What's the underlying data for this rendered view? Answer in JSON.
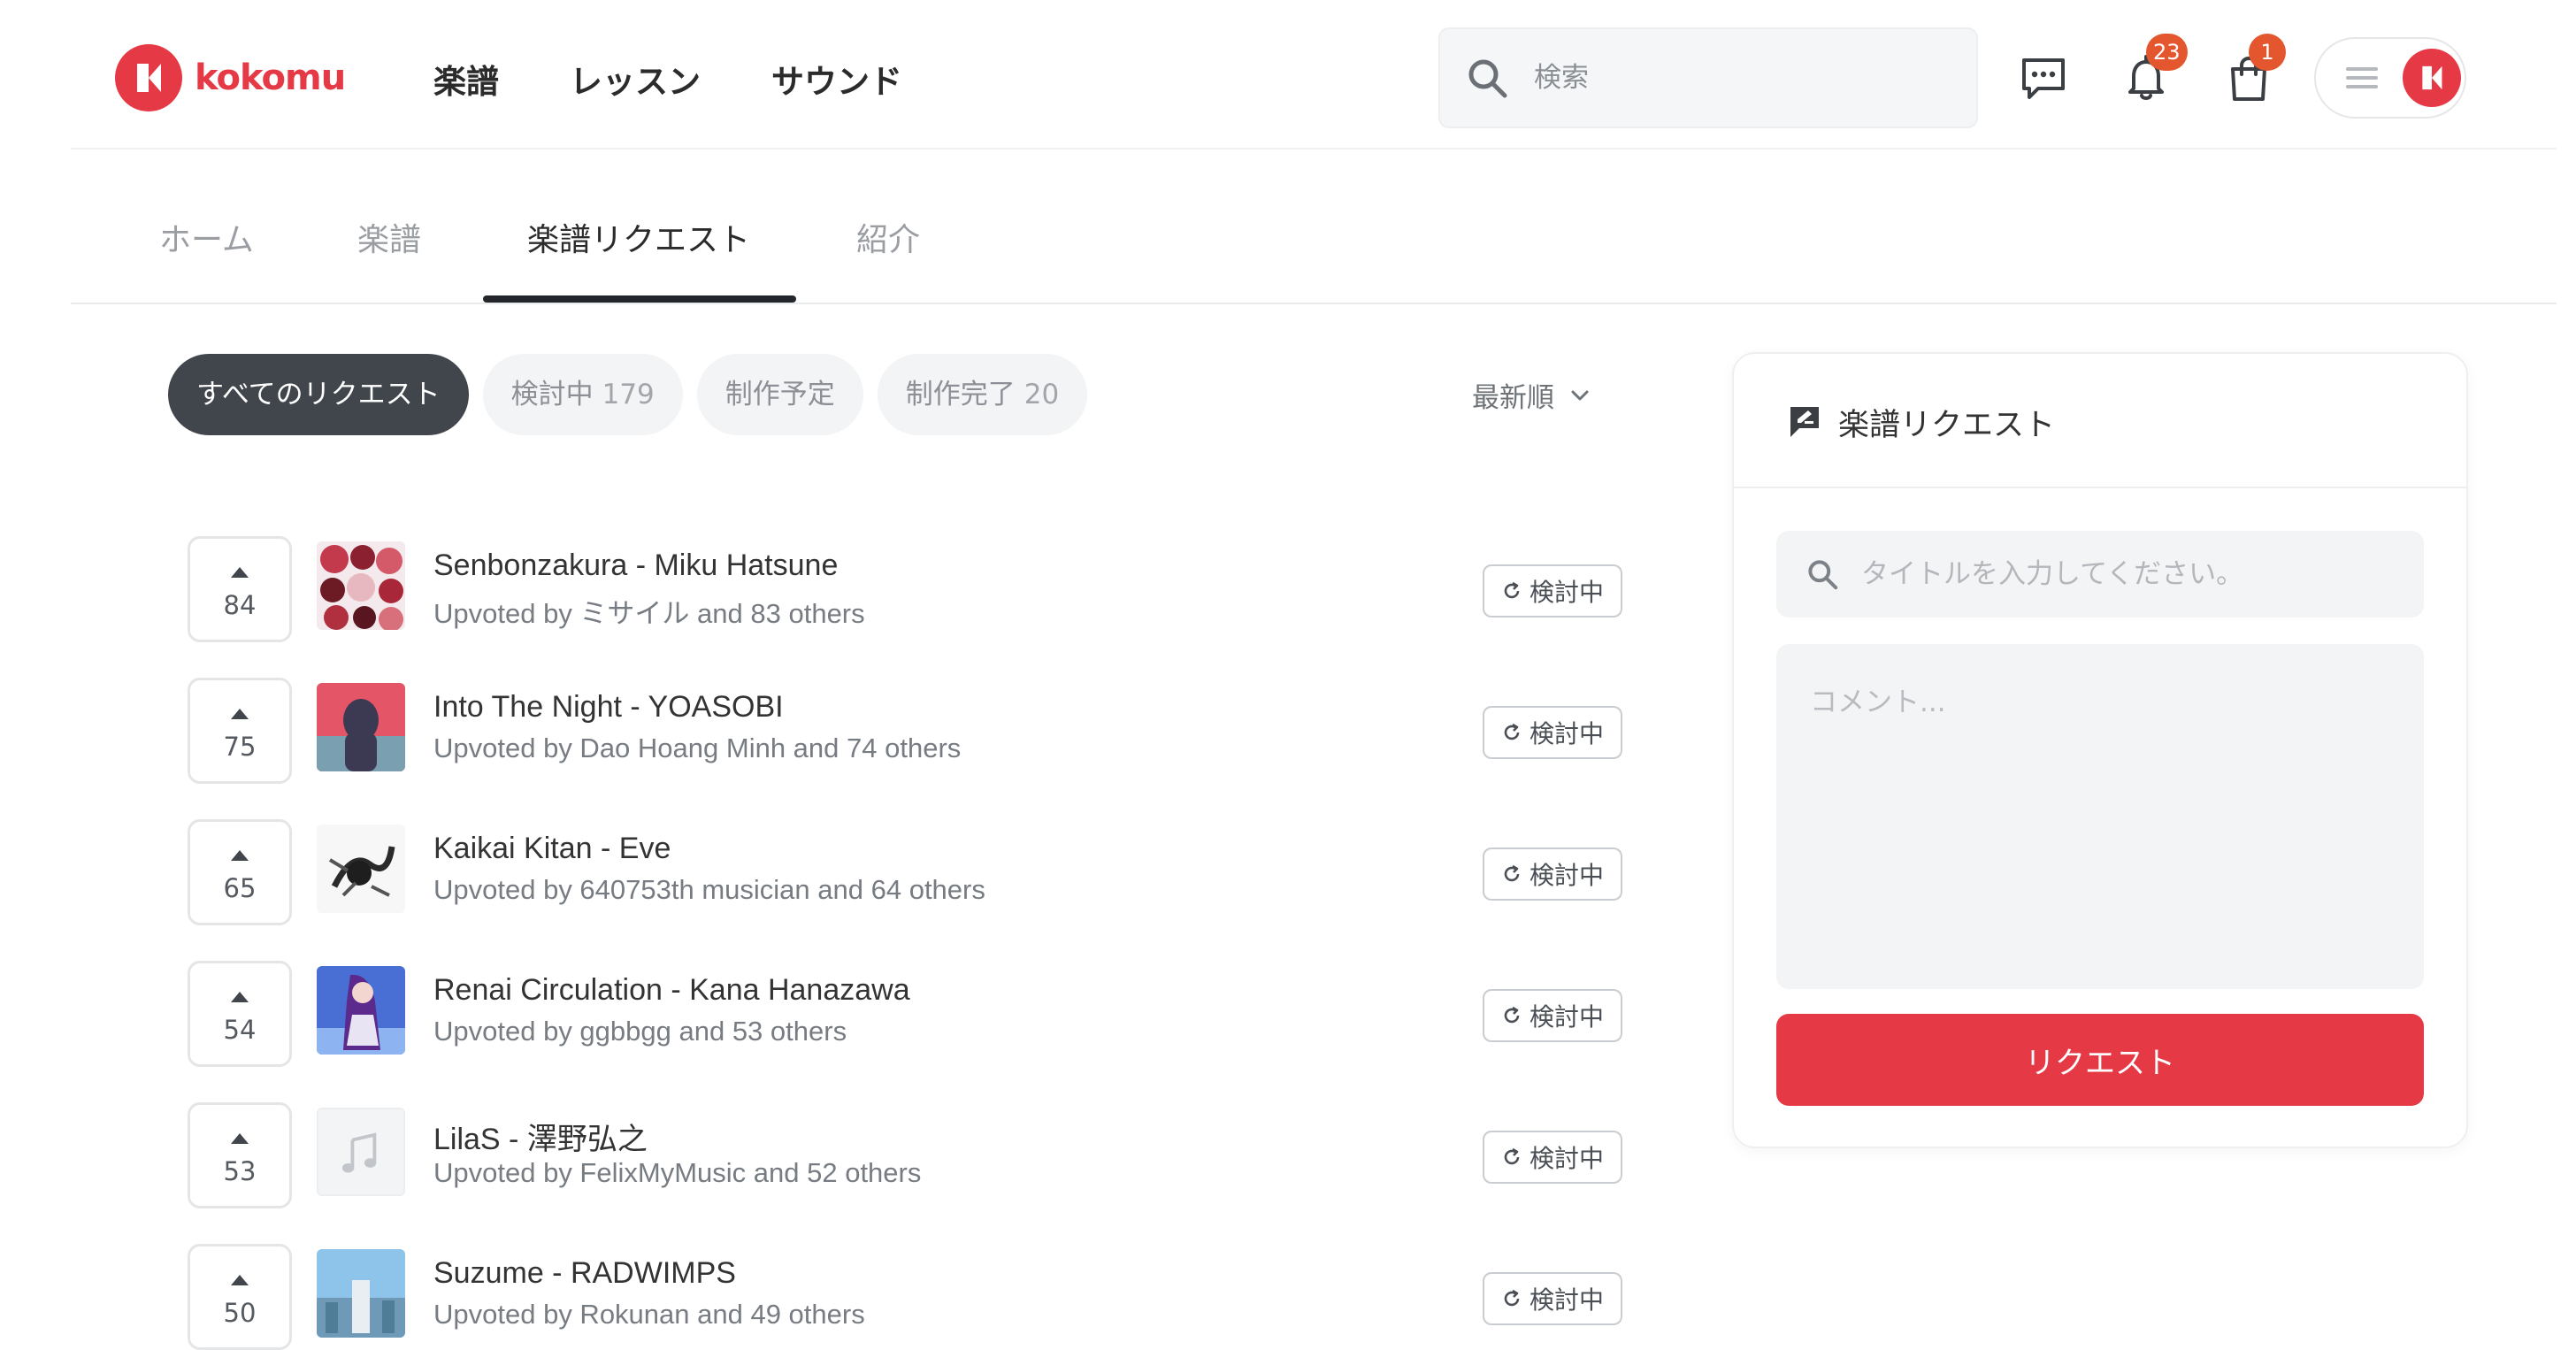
{
  "brand": {
    "name": "kokomu",
    "color": "#e63946"
  },
  "main_nav": [
    {
      "label": "楽譜"
    },
    {
      "label": "レッスン"
    },
    {
      "label": "サウンド"
    }
  ],
  "search": {
    "placeholder": "検索"
  },
  "header_icons": {
    "messages": {
      "icon": "chat-icon"
    },
    "notifications": {
      "icon": "bell-icon",
      "badge": "23"
    },
    "cart": {
      "icon": "shopping-bag-icon",
      "badge": "1"
    },
    "user_menu": {
      "icon": "menu-icon"
    }
  },
  "subtabs": [
    {
      "label": "ホーム",
      "active": false
    },
    {
      "label": "楽譜",
      "active": false
    },
    {
      "label": "楽譜リクエスト",
      "active": true
    },
    {
      "label": "紹介",
      "active": false
    }
  ],
  "filters": [
    {
      "label": "すべてのリクエスト",
      "count": "",
      "active": true
    },
    {
      "label": "検討中",
      "count": "179",
      "active": false
    },
    {
      "label": "制作予定",
      "count": "",
      "active": false
    },
    {
      "label": "制作完了",
      "count": "20",
      "active": false
    }
  ],
  "sort": {
    "label": "最新順"
  },
  "requests": [
    {
      "votes": "84",
      "title": "Senbonzakura - Miku Hatsune",
      "upvoted": "Upvoted by ミサイル and 83 others",
      "status": "検討中",
      "thumb": "collage"
    },
    {
      "votes": "75",
      "title": "Into The Night - YOASOBI",
      "upvoted": "Upvoted by Dao Hoang Minh and 74 others",
      "status": "検討中",
      "thumb": "red-silhouette"
    },
    {
      "votes": "65",
      "title": "Kaikai Kitan - Eve",
      "upvoted": "Upvoted by 640753th musician and 64 others",
      "status": "検討中",
      "thumb": "ink"
    },
    {
      "votes": "54",
      "title": "Renai Circulation - Kana Hanazawa",
      "upvoted": "Upvoted by ggbbgg and 53 others",
      "status": "検討中",
      "thumb": "purple-anime"
    },
    {
      "votes": "53",
      "title": "LilaS - 澤野弘之",
      "upvoted": "Upvoted by FelixMyMusic and 52 others",
      "status": "検討中",
      "thumb": "music-note"
    },
    {
      "votes": "50",
      "title": "Suzume - RADWIMPS",
      "upvoted": "Upvoted by Rokunan and 49 others",
      "status": "検討中",
      "thumb": "sky"
    }
  ],
  "panel": {
    "title": "楽譜リクエスト",
    "title_placeholder": "タイトルを入力してください。",
    "comment_placeholder": "コメント...",
    "submit_label": "リクエスト"
  }
}
